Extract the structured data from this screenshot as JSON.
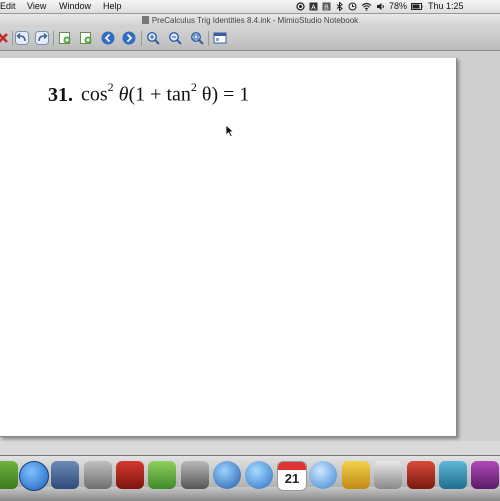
{
  "menubar": {
    "items": [
      "Edit",
      "View",
      "Window",
      "Help"
    ],
    "battery": "78%",
    "clock": "Thu 1:25"
  },
  "window": {
    "title": "PreCalculus Trig Identities 8.4.ink - MimioStudio Notebook"
  },
  "toolbar": {
    "buttons": [
      "undo-icon",
      "redo-icon",
      "add-page-icon",
      "insert-page-icon",
      "previous-page-icon",
      "next-page-icon",
      "zoom-in-icon",
      "zoom-out-icon",
      "zoom-fit-icon",
      "page-view-icon"
    ]
  },
  "page": {
    "problem_number": "31.",
    "expression": {
      "cos": "cos",
      "exp1": "2",
      "theta": "θ",
      "open": "(1 + tan",
      "exp2": "2",
      "close": " θ) = 1"
    }
  },
  "dock": {
    "calendar_day": "21"
  }
}
